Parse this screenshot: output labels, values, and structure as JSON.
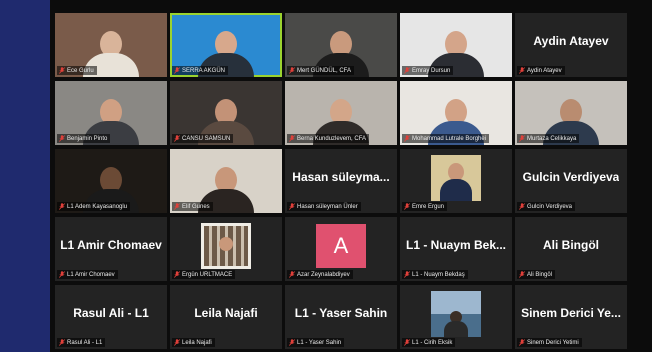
{
  "colors": {
    "active_border": "#9bd32f",
    "mic_muted": "#e0403a",
    "avatar_a": "#e0516f"
  },
  "participants": [
    {
      "label": "Ece Gurlu",
      "display": "",
      "video": true,
      "skin": "#d9b49a",
      "bg": "#7a5b4a",
      "shirt": "#e8e2d8"
    },
    {
      "label": "SERRA AKGÜN",
      "display": "",
      "video": true,
      "skin": "#d7a88c",
      "bg": "#2b8ad1",
      "shirt": "#27303b",
      "active": true
    },
    {
      "label": "Mert GÜNDÜL, CFA",
      "display": "",
      "video": true,
      "skin": "#c99a7d",
      "bg": "#4a4a48",
      "shirt": "#1c1c1c"
    },
    {
      "label": "Emray Dursun",
      "display": "",
      "video": true,
      "skin": "#d4a58a",
      "bg": "#e6e6e6",
      "shirt": "#2b2d33"
    },
    {
      "label": "Aydin Atayev",
      "display": "Aydin Atayev",
      "video": false
    },
    {
      "label": "Benjamin Pinto",
      "display": "",
      "video": true,
      "skin": "#d0a083",
      "bg": "#8a8884",
      "shirt": "#3b3d42"
    },
    {
      "label": "CANSU SAMSUN",
      "display": "",
      "video": true,
      "skin": "#c39277",
      "bg": "#3a3532",
      "shirt": "#5a4a40"
    },
    {
      "label": "Berna Kunduzlevem, CFA",
      "display": "",
      "video": true,
      "skin": "#d3a689",
      "bg": "#b9b4ad",
      "shirt": "#2f2b29"
    },
    {
      "label": "Mohammad Lutrale Borghei",
      "display": "",
      "video": true,
      "skin": "#d2a286",
      "bg": "#e9e6e1",
      "shirt": "#3b5a8e"
    },
    {
      "label": "Murtaza Celikkaya",
      "display": "",
      "video": true,
      "skin": "#b98c70",
      "bg": "#c5c1bb",
      "shirt": "#2d3a4d"
    },
    {
      "label": "L1 Adem Kayasanoglu",
      "display": "",
      "video": true,
      "skin": "#6b4a35",
      "bg": "#1e1a16",
      "shirt": "#1a1a1a"
    },
    {
      "label": "Elif Gunes",
      "display": "",
      "video": true,
      "skin": "#c8977a",
      "bg": "#d8d2c8",
      "shirt": "#2a2421"
    },
    {
      "label": "Hasan süleyman Ünler",
      "display": "Hasan süleyma...",
      "video": false
    },
    {
      "label": "Emre Ergun",
      "display": "",
      "video": false,
      "thumb": "suit"
    },
    {
      "label": "Gulcin Verdiyeva",
      "display": "Gulcin Verdiyeva",
      "video": false
    },
    {
      "label": "L1 Amir Chomaev",
      "display": "L1 Amir Chomaev",
      "video": false
    },
    {
      "label": "Ergün URLTMACE",
      "display": "",
      "video": false,
      "thumb": "shelf"
    },
    {
      "label": "Azar Zeynalabdiyev",
      "display": "",
      "video": false,
      "avatar": "A"
    },
    {
      "label": "L1 - Nuaym Bekdaş",
      "display": "L1 - Nuaym Bek...",
      "video": false
    },
    {
      "label": "Ali Bingöl",
      "display": "Ali Bingöl",
      "video": false
    },
    {
      "label": "Rasul Ali - L1",
      "display": "Rasul Ali - L1",
      "video": false
    },
    {
      "label": "Leila Najafi",
      "display": "Leila Najafi",
      "video": false
    },
    {
      "label": "L1 - Yaser Sahin",
      "display": "L1 - Yaser Sahin",
      "video": false
    },
    {
      "label": "L1 - Cirih Eksik",
      "display": "",
      "video": false,
      "thumb": "sea"
    },
    {
      "label": "Sinem Derici Yetimi",
      "display": "Sinem Derici Ye...",
      "video": false
    }
  ]
}
